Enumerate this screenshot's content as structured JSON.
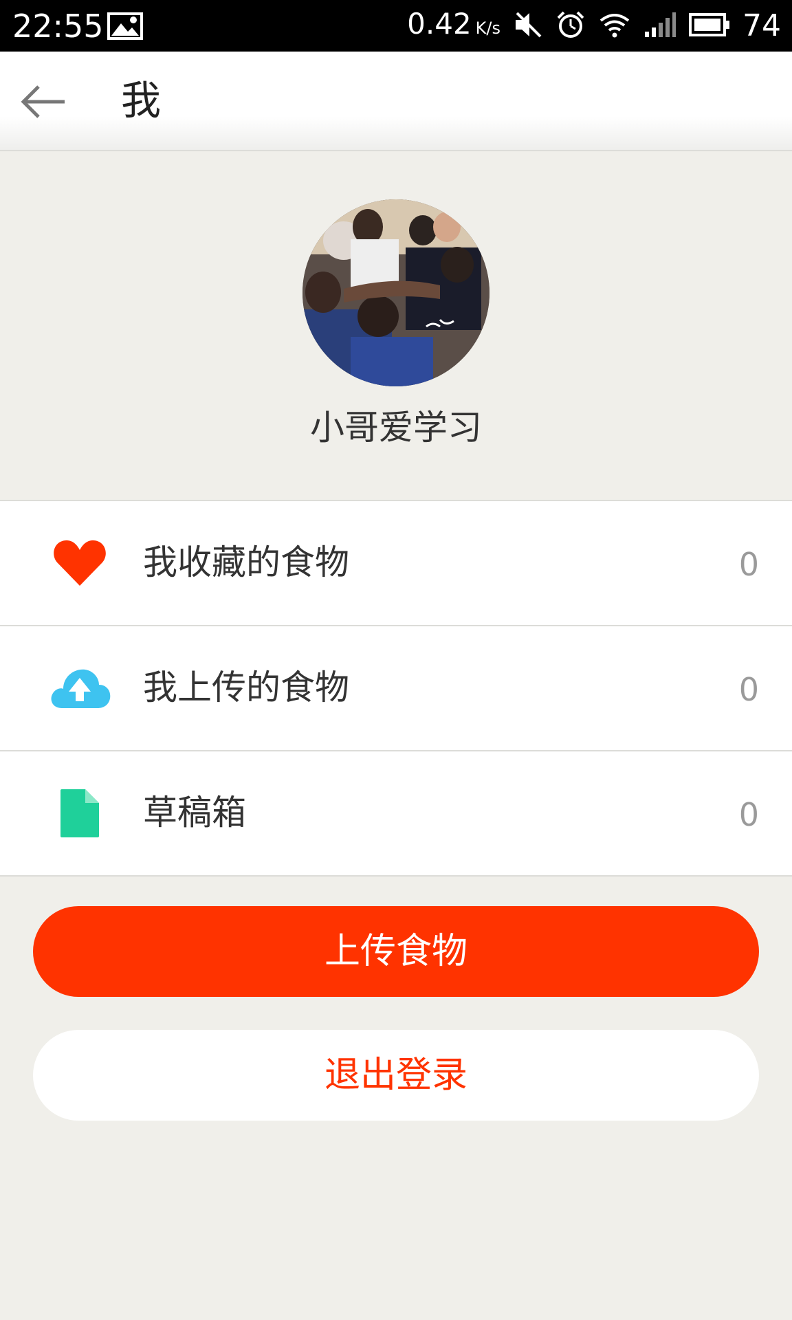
{
  "status_bar": {
    "time": "22:55",
    "net_speed": "0.42",
    "net_speed_unit": "K/s",
    "battery_level": "74",
    "icons": [
      "gallery-icon",
      "mute-icon",
      "alarm-icon",
      "wifi-icon",
      "signal-icon",
      "battery-icon"
    ]
  },
  "app_bar": {
    "title": "我",
    "back_icon": "arrow-left-icon"
  },
  "profile": {
    "username": "小哥爱学习"
  },
  "menu": {
    "items": [
      {
        "label": "我收藏的食物",
        "count": "0",
        "icon": "heart-icon",
        "icon_color": "#ff3300"
      },
      {
        "label": "我上传的食物",
        "count": "0",
        "icon": "cloud-upload-icon",
        "icon_color": "#3ec3f0"
      },
      {
        "label": "草稿箱",
        "count": "0",
        "icon": "document-icon",
        "icon_color": "#1fd09a"
      }
    ]
  },
  "buttons": {
    "upload_label": "上传食物",
    "logout_label": "退出登录"
  },
  "colors": {
    "accent": "#ff3300",
    "background": "#f0efea"
  }
}
